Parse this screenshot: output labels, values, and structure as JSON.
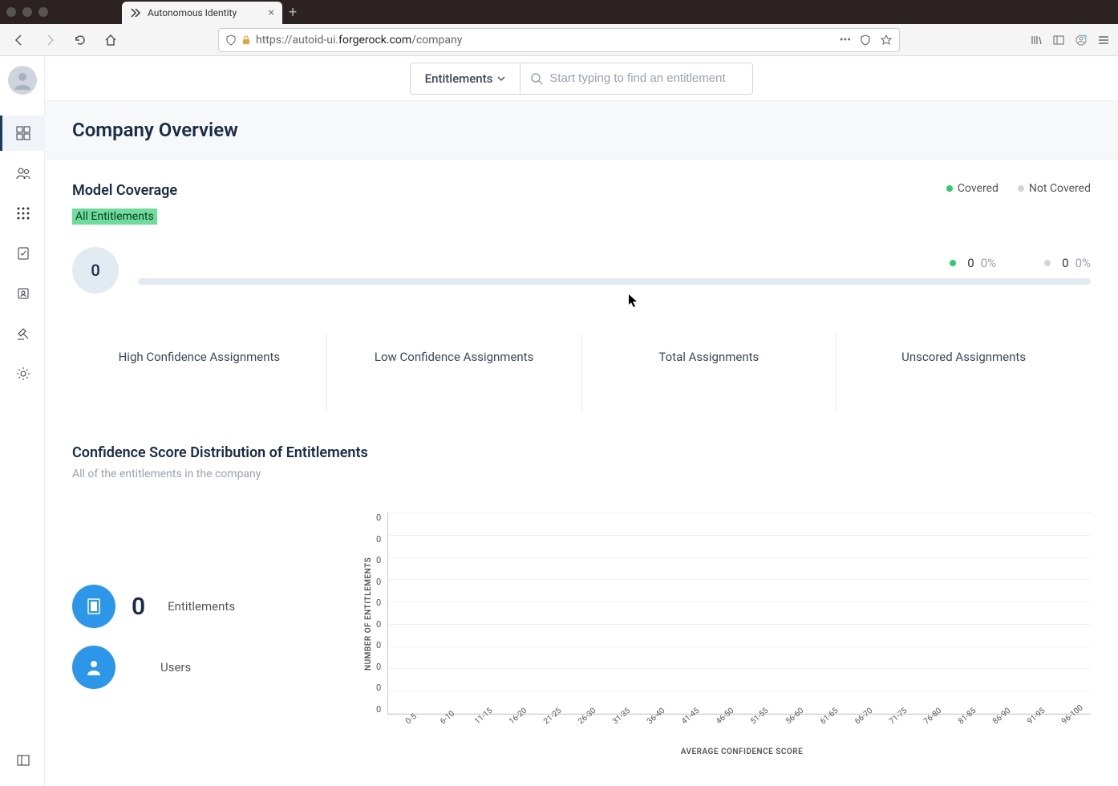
{
  "browser": {
    "tab_title": "Autonomous Identity",
    "url_display": "https://autoid-ui.forgerock.com/company",
    "url_domain": "forgerock.com"
  },
  "search": {
    "dropdown_label": "Entitlements",
    "placeholder": "Start typing to find an entitlement"
  },
  "page": {
    "title": "Company Overview"
  },
  "coverage": {
    "title": "Model Coverage",
    "filter": "All Entitlements",
    "legend_covered": "Covered",
    "legend_not_covered": "Not Covered",
    "total": "0",
    "covered_count": "0",
    "covered_pct": "0%",
    "not_covered_count": "0",
    "not_covered_pct": "0%"
  },
  "stats": {
    "high": "High Confidence Assignments",
    "low": "Low Confidence Assignments",
    "total": "Total Assignments",
    "unscored": "Unscored Assignments"
  },
  "distribution": {
    "title": "Confidence Score Distribution of Entitlements",
    "subtitle": "All of the entitlements in the company",
    "entitlements_count": "0",
    "entitlements_label": "Entitlements",
    "users_label": "Users",
    "y_label": "NUMBER OF ENTITLEMENTS",
    "x_label": "AVERAGE CONFIDENCE SCORE"
  },
  "chart_data": {
    "type": "bar",
    "categories": [
      "0-5",
      "6-10",
      "11-15",
      "16-20",
      "21-25",
      "26-30",
      "31-35",
      "36-40",
      "41-45",
      "46-50",
      "51-55",
      "56-60",
      "61-65",
      "66-70",
      "71-75",
      "76-80",
      "81-85",
      "86-90",
      "91-95",
      "96-100"
    ],
    "values": [
      0,
      0,
      0,
      0,
      0,
      0,
      0,
      0,
      0,
      0,
      0,
      0,
      0,
      0,
      0,
      0,
      0,
      0,
      0,
      0
    ],
    "y_ticks": [
      "0",
      "0",
      "0",
      "0",
      "0",
      "0",
      "0",
      "0",
      "0",
      "0"
    ],
    "title": "Confidence Score Distribution of Entitlements",
    "xlabel": "AVERAGE CONFIDENCE SCORE",
    "ylabel": "NUMBER OF ENTITLEMENTS",
    "ylim": [
      0,
      0
    ]
  }
}
